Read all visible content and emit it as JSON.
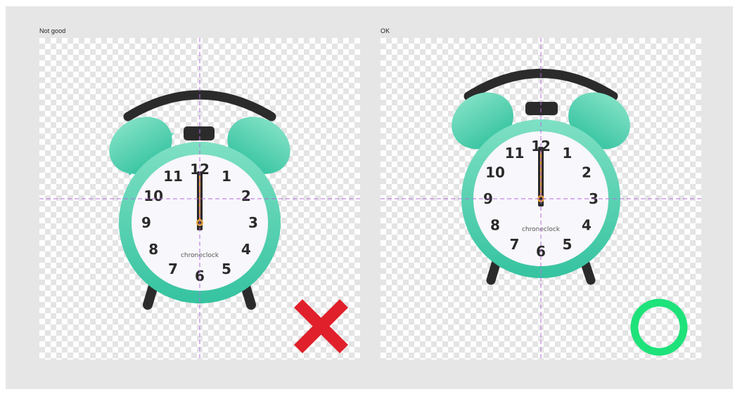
{
  "panels": [
    {
      "label": "Not good",
      "brand": "chroneclock",
      "numbers": [
        "12",
        "1",
        "2",
        "3",
        "4",
        "5",
        "6",
        "7",
        "8",
        "9",
        "10",
        "11"
      ],
      "verdict_icon": "cross-mark-icon",
      "verdict_color": "#e0202a"
    },
    {
      "label": "OK",
      "brand": "chroneclock",
      "numbers": [
        "12",
        "1",
        "2",
        "3",
        "4",
        "5",
        "6",
        "7",
        "8",
        "9",
        "10",
        "11"
      ],
      "verdict_icon": "circle-mark-icon",
      "verdict_color": "#1ee27a"
    }
  ],
  "colors": {
    "clock_teal_light": "#7fe0c4",
    "clock_teal_dark": "#35c3a0",
    "face": "#f8f7fb",
    "dark": "#2b2b2b",
    "guide": "#b46be0",
    "center_dot": "#e8a23a"
  }
}
